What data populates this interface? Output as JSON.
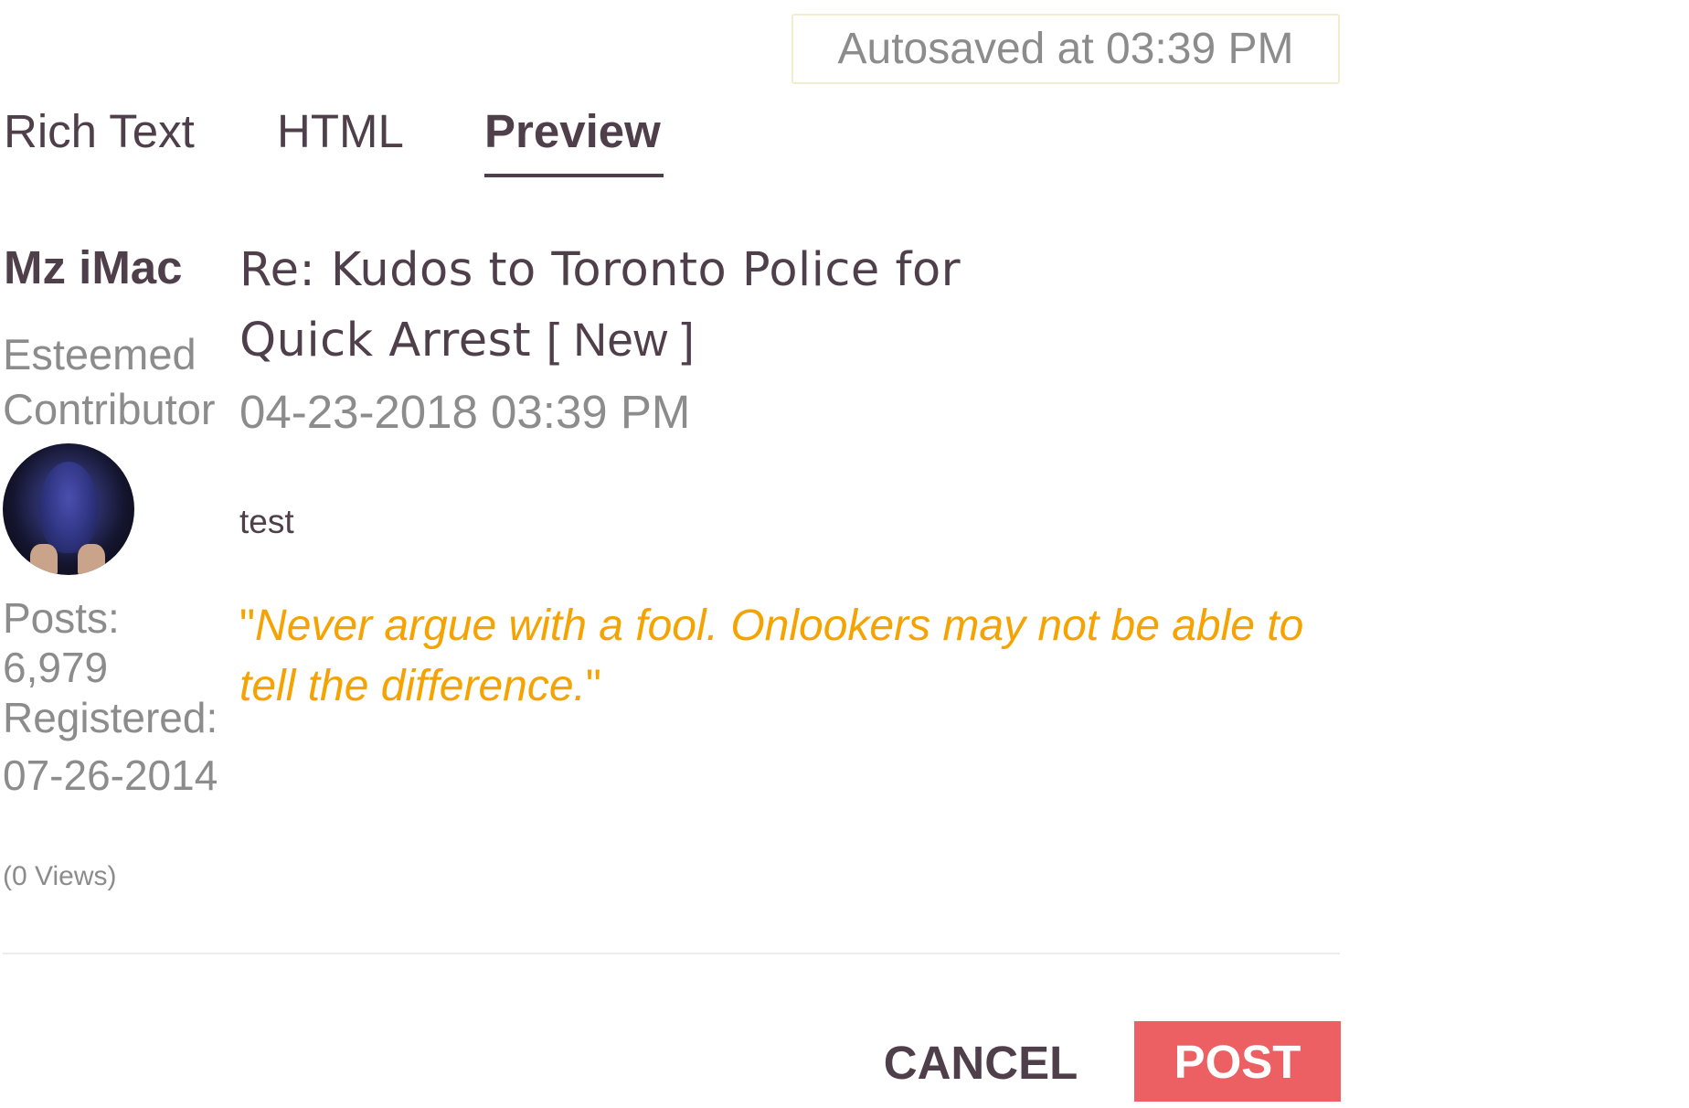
{
  "autosave": {
    "text": "Autosaved at 03:39 PM"
  },
  "tabs": [
    {
      "label": "Rich Text",
      "active": false
    },
    {
      "label": "HTML",
      "active": false
    },
    {
      "label": "Preview",
      "active": true
    }
  ],
  "author": {
    "name": "Mz iMac",
    "rank": "Esteemed Contributor",
    "avatar": "user-avatar",
    "posts_label": "Posts:",
    "posts_value": "6,979",
    "registered_label": "Registered:",
    "registered_value": "07-26-2014"
  },
  "message": {
    "subject": "Re: Kudos to Toronto Police for Quick Arrest",
    "new_tag": "[ New ]",
    "date": "04-23-2018 03:39 PM",
    "body": "test",
    "quote_open": "\"",
    "quote_text": "Never argue with a fool. Onlookers may not be able to tell the difference.",
    "quote_close": "\""
  },
  "views": "(0 Views)",
  "buttons": {
    "cancel": "CANCEL",
    "post": "POST"
  },
  "colors": {
    "text_primary": "#4f3f4b",
    "text_muted": "#8c8c8c",
    "quote": "#f5a300",
    "post_button": "#ec5f63",
    "autosave_border": "#f4ecd0"
  }
}
